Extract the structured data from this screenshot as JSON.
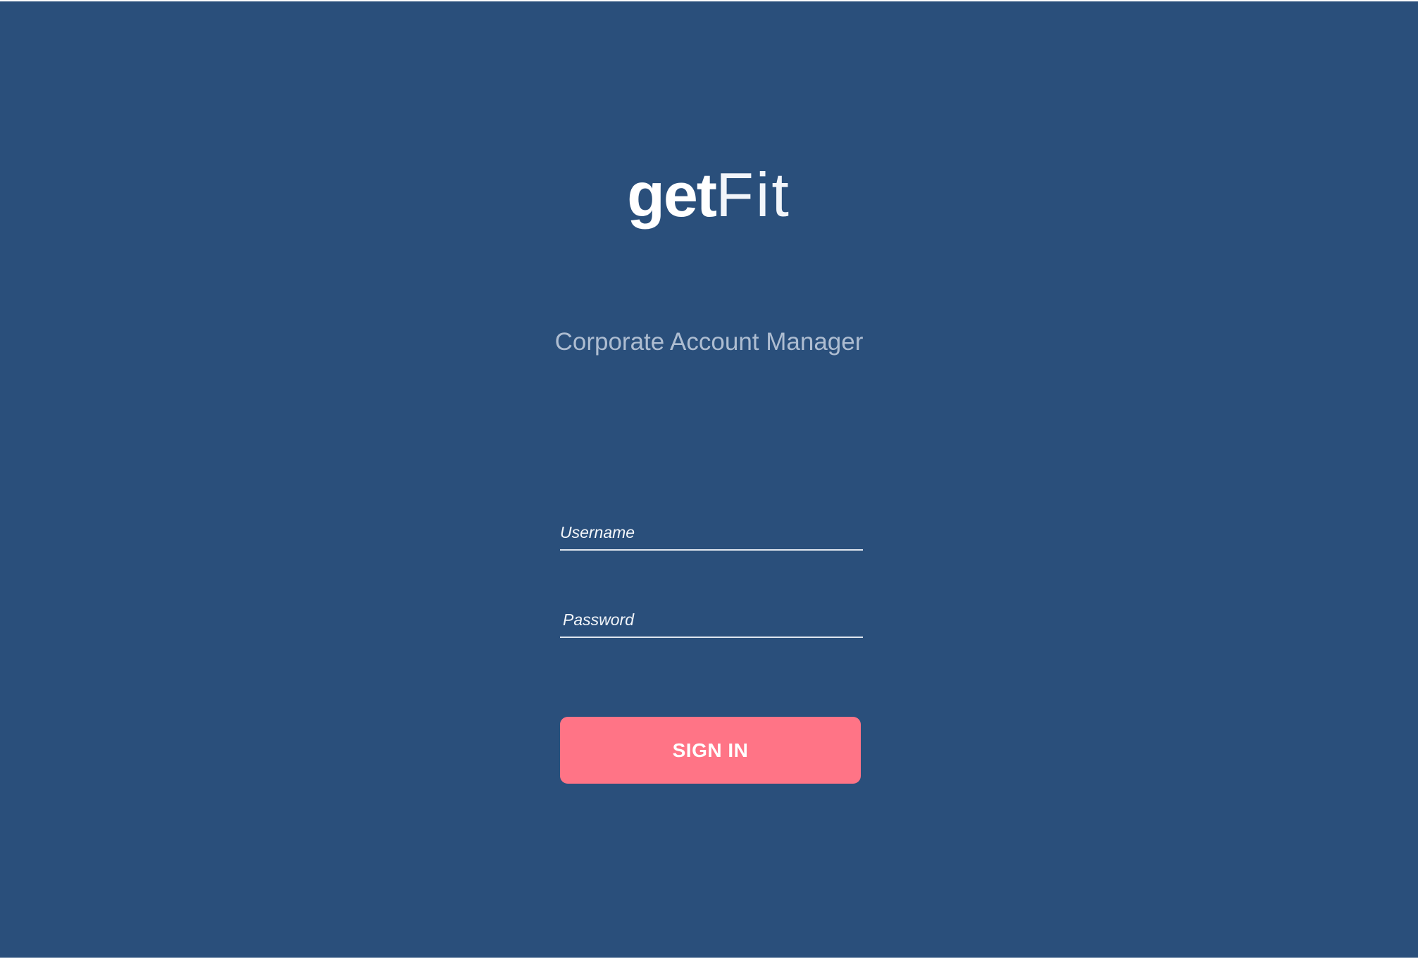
{
  "brand": {
    "logo_bold": "get",
    "logo_light": "Fit"
  },
  "page": {
    "subtitle": "Corporate Account Manager"
  },
  "login": {
    "username_placeholder": "Username",
    "username_value": "",
    "password_placeholder": "Password",
    "password_value": "",
    "signin_label": "SIGN IN"
  },
  "colors": {
    "background": "#2a4f7b",
    "accent": "#ff7486",
    "subtitle_text": "#aebdd1",
    "input_underline": "#dfe6ef"
  }
}
